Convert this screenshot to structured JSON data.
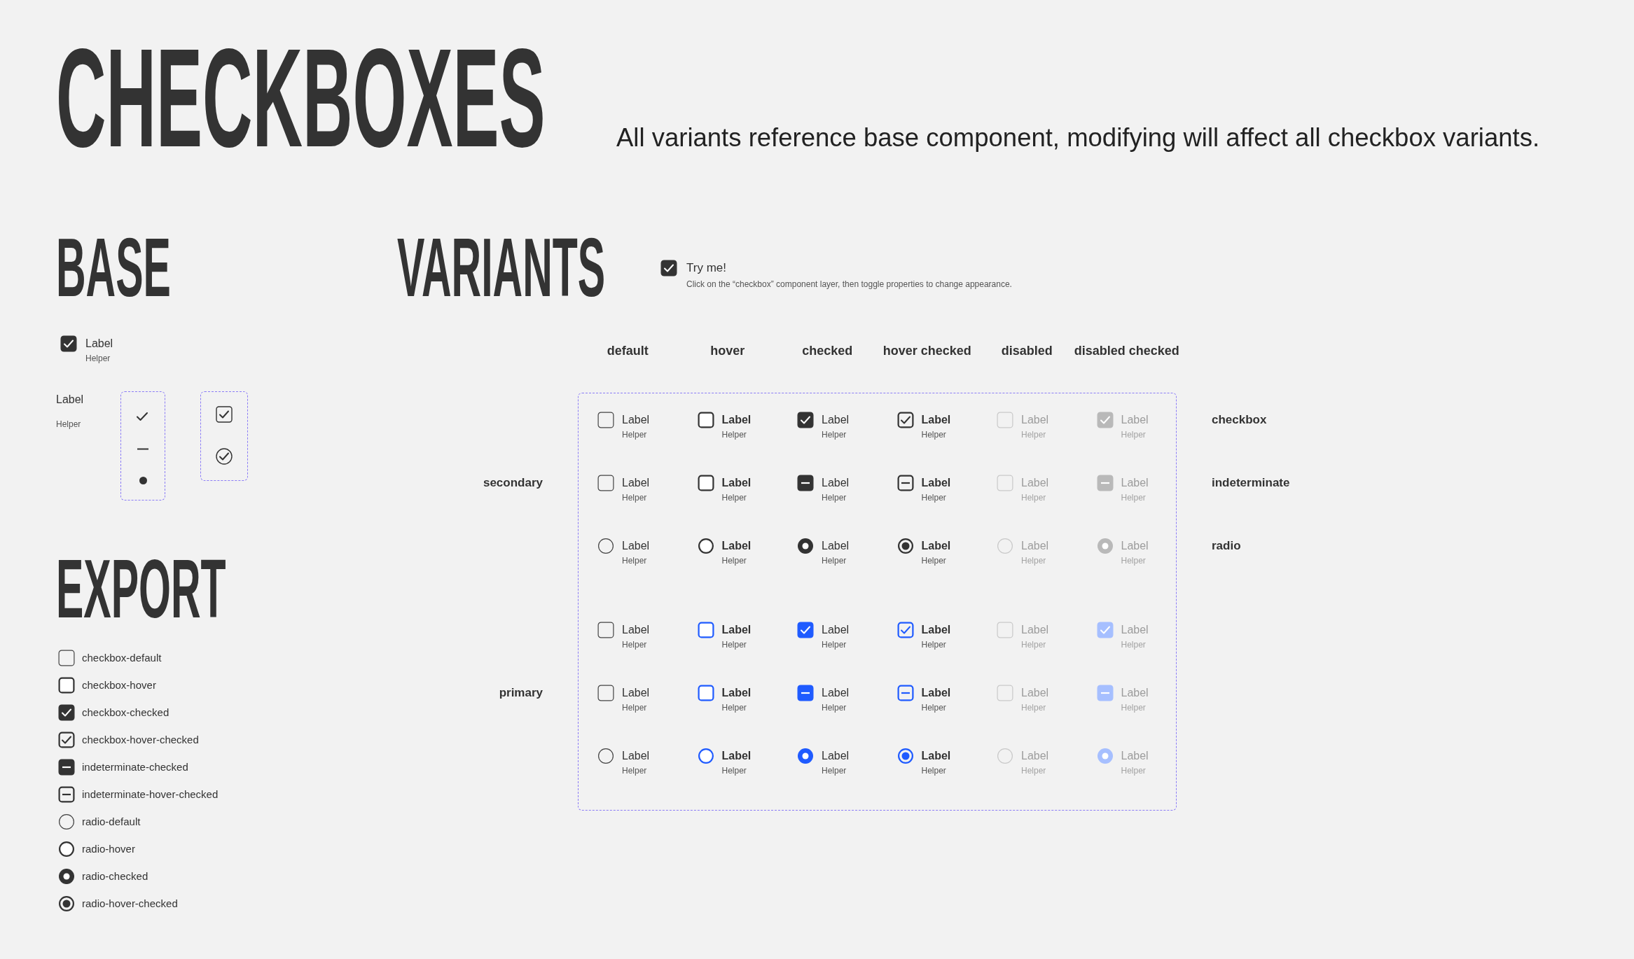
{
  "title": "CHECKBOXES",
  "subtitle": "All variants reference base component, modifying will affect all checkbox variants.",
  "base": {
    "heading": "BASE",
    "sample": {
      "label": "Label",
      "helper": "Helper",
      "checked": true
    },
    "parts": {
      "label": "Label",
      "helper": "Helper"
    }
  },
  "export": {
    "heading": "EXPORT",
    "items": [
      {
        "label": "checkbox-default",
        "kind": "checkbox",
        "checked": false,
        "hover": false
      },
      {
        "label": "checkbox-hover",
        "kind": "checkbox",
        "checked": false,
        "hover": true
      },
      {
        "label": "checkbox-checked",
        "kind": "checkbox",
        "checked": true,
        "hover": false
      },
      {
        "label": "checkbox-hover-checked",
        "kind": "checkbox",
        "checked": true,
        "hover": true
      },
      {
        "label": "indeterminate-checked",
        "kind": "indeterminate",
        "checked": true,
        "hover": false
      },
      {
        "label": "indeterminate-hover-checked",
        "kind": "indeterminate",
        "checked": true,
        "hover": true
      },
      {
        "label": "radio-default",
        "kind": "radio",
        "checked": false,
        "hover": false
      },
      {
        "label": "radio-hover",
        "kind": "radio",
        "checked": false,
        "hover": true
      },
      {
        "label": "radio-checked",
        "kind": "radio",
        "checked": true,
        "hover": false
      },
      {
        "label": "radio-hover-checked",
        "kind": "radio",
        "checked": true,
        "hover": true
      }
    ]
  },
  "variants": {
    "heading": "VARIANTS",
    "try_me": {
      "label": "Try me!",
      "checked": true,
      "helper": "Click on the “checkbox” component layer, then toggle properties to change appearance."
    },
    "columns": [
      "default",
      "hover",
      "checked",
      "hover checked",
      "disabled",
      "disabled checked"
    ],
    "groups": [
      {
        "label": "secondary",
        "kind": "secondary",
        "rows": [
          {
            "kind": "checkbox",
            "type_label": "checkbox",
            "cells": [
              {
                "label": "Label",
                "helper": "Helper",
                "checked": false,
                "hover": false,
                "disabled": false
              },
              {
                "label": "Label",
                "helper": "Helper",
                "checked": false,
                "hover": true,
                "disabled": false
              },
              {
                "label": "Label",
                "helper": "Helper",
                "checked": true,
                "hover": false,
                "disabled": false
              },
              {
                "label": "Label",
                "helper": "Helper",
                "checked": true,
                "hover": true,
                "disabled": false
              },
              {
                "label": "Label",
                "helper": "Helper",
                "checked": false,
                "hover": false,
                "disabled": true
              },
              {
                "label": "Label",
                "helper": "Helper",
                "checked": true,
                "hover": false,
                "disabled": true
              }
            ]
          },
          {
            "kind": "indeterminate",
            "type_label": "indeterminate",
            "cells": [
              {
                "label": "Label",
                "helper": "Helper",
                "checked": false,
                "hover": false,
                "disabled": false
              },
              {
                "label": "Label",
                "helper": "Helper",
                "checked": false,
                "hover": true,
                "disabled": false
              },
              {
                "label": "Label",
                "helper": "Helper",
                "checked": true,
                "hover": false,
                "disabled": false
              },
              {
                "label": "Label",
                "helper": "Helper",
                "checked": true,
                "hover": true,
                "disabled": false
              },
              {
                "label": "Label",
                "helper": "Helper",
                "checked": false,
                "hover": false,
                "disabled": true
              },
              {
                "label": "Label",
                "helper": "Helper",
                "checked": true,
                "hover": false,
                "disabled": true
              }
            ]
          },
          {
            "kind": "radio",
            "type_label": "radio",
            "cells": [
              {
                "label": "Label",
                "helper": "Helper",
                "checked": false,
                "hover": false,
                "disabled": false
              },
              {
                "label": "Label",
                "helper": "Helper",
                "checked": false,
                "hover": true,
                "disabled": false
              },
              {
                "label": "Label",
                "helper": "Helper",
                "checked": true,
                "hover": false,
                "disabled": false
              },
              {
                "label": "Label",
                "helper": "Helper",
                "checked": true,
                "hover": true,
                "disabled": false
              },
              {
                "label": "Label",
                "helper": "Helper",
                "checked": false,
                "hover": false,
                "disabled": true
              },
              {
                "label": "Label",
                "helper": "Helper",
                "checked": true,
                "hover": false,
                "disabled": true
              }
            ]
          }
        ]
      },
      {
        "label": "primary",
        "kind": "primary",
        "rows": [
          {
            "kind": "checkbox",
            "cells": [
              {
                "label": "Label",
                "helper": "Helper",
                "checked": false,
                "hover": false,
                "disabled": false
              },
              {
                "label": "Label",
                "helper": "Helper",
                "checked": false,
                "hover": true,
                "disabled": false
              },
              {
                "label": "Label",
                "helper": "Helper",
                "checked": true,
                "hover": false,
                "disabled": false
              },
              {
                "label": "Label",
                "helper": "Helper",
                "checked": true,
                "hover": true,
                "disabled": false
              },
              {
                "label": "Label",
                "helper": "Helper",
                "checked": false,
                "hover": false,
                "disabled": true
              },
              {
                "label": "Label",
                "helper": "Helper",
                "checked": true,
                "hover": false,
                "disabled": true
              }
            ]
          },
          {
            "kind": "indeterminate",
            "cells": [
              {
                "label": "Label",
                "helper": "Helper",
                "checked": false,
                "hover": false,
                "disabled": false
              },
              {
                "label": "Label",
                "helper": "Helper",
                "checked": false,
                "hover": true,
                "disabled": false
              },
              {
                "label": "Label",
                "helper": "Helper",
                "checked": true,
                "hover": false,
                "disabled": false
              },
              {
                "label": "Label",
                "helper": "Helper",
                "checked": true,
                "hover": true,
                "disabled": false
              },
              {
                "label": "Label",
                "helper": "Helper",
                "checked": false,
                "hover": false,
                "disabled": true
              },
              {
                "label": "Label",
                "helper": "Helper",
                "checked": true,
                "hover": false,
                "disabled": true
              }
            ]
          },
          {
            "kind": "radio",
            "cells": [
              {
                "label": "Label",
                "helper": "Helper",
                "checked": false,
                "hover": false,
                "disabled": false
              },
              {
                "label": "Label",
                "helper": "Helper",
                "checked": false,
                "hover": true,
                "disabled": false
              },
              {
                "label": "Label",
                "helper": "Helper",
                "checked": true,
                "hover": false,
                "disabled": false
              },
              {
                "label": "Label",
                "helper": "Helper",
                "checked": true,
                "hover": true,
                "disabled": false
              },
              {
                "label": "Label",
                "helper": "Helper",
                "checked": false,
                "hover": false,
                "disabled": true
              },
              {
                "label": "Label",
                "helper": "Helper",
                "checked": true,
                "hover": false,
                "disabled": true
              }
            ]
          }
        ]
      }
    ]
  }
}
